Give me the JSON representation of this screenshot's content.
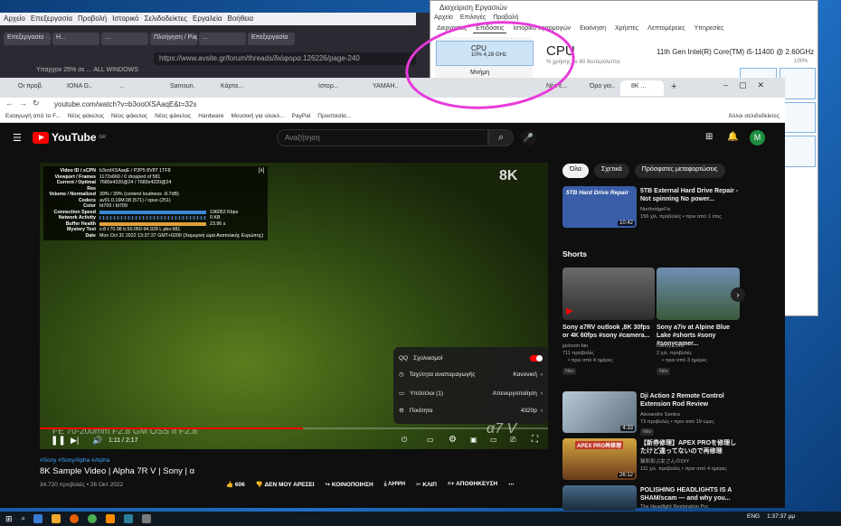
{
  "firefox": {
    "menu": [
      "Αρχείο",
      "Επεξεργασία",
      "Προβολή",
      "Ιστορικό",
      "Σελιδοδείκτες",
      "Εργαλεία",
      "Βοήθεια"
    ],
    "tabs": [
      "Επεξεργασία · ...",
      "Η...",
      "...",
      "Πλοήγηση / Page",
      "...",
      "Επεξεργασία"
    ],
    "url": "https://www.avsite.gr/forum/threads/διάφορα.126226/page-240",
    "bookmarks": "Υπάρχον 25% σε ...   ALL WINDOWS"
  },
  "task_manager": {
    "title": "Διαχείριση Εργασιών",
    "menu": [
      "Αρχείο",
      "Επιλογές",
      "Προβολή"
    ],
    "tabs": [
      "Διεργασίες",
      "Επιδόσεις",
      "Ιστορικό εφαρμογών",
      "Εκκίνηση",
      "Χρήστες",
      "Λεπτομέρειες",
      "Υπηρεσίες"
    ],
    "cpu_label": "CPU",
    "cpu_value": "10%  4,28 GHz",
    "mem_label": "Μνήμη",
    "heading": "CPU",
    "model": "11th Gen Intel(R) Core(TM) i5-11400 @ 2.60GHz",
    "sub": "% χρήσης σε 60 δευτερόλεπτα",
    "pct": "100%"
  },
  "chrome": {
    "tabs": [
      "Οι προβ...",
      "IONA G...",
      "...",
      "Samsun...",
      "Κάρτα...",
      "Νέα...",
      "Ιστορ...",
      "...",
      "YAMAH...",
      "...",
      "BENQ...",
      "Νέα ε...",
      "Όρο γιο...",
      "8K ..."
    ],
    "url": "youtube.com/watch?v=b3ootXSAaqE&t=32s",
    "bookmarks": [
      "Εισαγωγή από το F...",
      "Νέος φάκελος",
      "Νέος φάκελος",
      "Νέος φάκελος",
      "Hardware",
      "Μουσική για ολοκλ...",
      "PayPal",
      "Προστασία...",
      "Άλλοι σελιδοδείκτες"
    ]
  },
  "youtube": {
    "logo": "YouTube",
    "country": "GR",
    "search_placeholder": "Αναζήτηση",
    "avatar": "M",
    "stats": [
      [
        "Video ID / sCPN",
        "b3ootXSAaqE  / P2P5 8V8T 1TF8"
      ],
      [
        "Viewport / Frames",
        "1172x660 / 0 dropped of 581"
      ],
      [
        "Current / Optimal Res",
        "7680x4320@24 / 7680x4320@24"
      ],
      [
        "Volume / Normalized",
        "39% / 39% (content loudness -8.7dB)"
      ],
      [
        "Codecs",
        "av01.0.16M.08 (571) / opus (251)"
      ],
      [
        "Color",
        "bt709 / bt709"
      ],
      [
        "Connection Speed",
        "196052 Kbps"
      ],
      [
        "Network Activity",
        "0 KB"
      ],
      [
        "Buffer Health",
        "23.96 s"
      ],
      [
        "Mystery Text",
        "s:8 t:70.98 b:50.050-94.928 L pbs:981"
      ],
      [
        "Date",
        "Mon Oct 31 2022 13:37:37 GMT+0200 (Χειμερινή ώρα Ανατολικής Ευρώπης)"
      ]
    ],
    "badge_8k": "8K",
    "lens": "FE 70-200mm F2.8 GM OSS II  F2.8",
    "sony": "α7 V",
    "settings": [
      {
        "label": "Σχολιασμοί",
        "value": ""
      },
      {
        "label": "Ταχύτητα αναπαραγωγής",
        "value": "Κανονική"
      },
      {
        "label": "Υπότιτλοι (1)",
        "value": "Απενεργοποίηση"
      },
      {
        "label": "Ποιότητα",
        "value": "4320p"
      }
    ],
    "time": "1:11 / 2:17",
    "tags": "#Sony  #SonyAlpha  #Alpha",
    "title": "8K Sample Video | Alpha 7R V | Sony | α",
    "meta": "34.720 προβολές • 26 Οκτ 2022",
    "actions": [
      "606",
      "ΔΕΝ ΜΟΥ ΑΡΕΣΕΙ",
      "ΚΟΙΝΟΠΟΙΗΣΗ",
      "ΛΗΨΗ",
      "ΚΛΙΠ",
      "ΑΠΟΘΗΚΕΥΣΗ"
    ],
    "chips": [
      "Όλα",
      "Σχετικά",
      "Πρόσφατες μεταφορτώσεις"
    ],
    "rec1": {
      "title": "5TB External Hard Drive Repair - Not spinning No power...",
      "channel": "NorthridgeFix",
      "meta": "156 χιλ. προβολές • πριν από 1 έτος",
      "dur": "10:42",
      "thumb_text": "5TB Hard Drive Repair"
    },
    "shorts_heading": "Shorts",
    "shorts": [
      {
        "title": "Sony a7RV outlook ,8K 30fps or 4K 60fps #sony #camera...",
        "channel": "jackson fan",
        "views": "711 προβολές",
        "age": "• πριν από 4 ημέρες",
        "badge": "Νέο"
      },
      {
        "title": "Sony a7iv at Alpine Blue Lake #shorts #sony #sonycamer...",
        "channel": "Danny Cook",
        "views": "2 χιλ. προβολές",
        "age": "• πριν από 3 ημέρες",
        "badge": "Νέο"
      }
    ],
    "rec2": {
      "title": "Dji Action 2 Remote Control Extension Rod Review",
      "channel": "Alexandre Santos",
      "meta": "73 προβολές • πριν από 19 ώρες",
      "dur": "4:33",
      "badge": "Νέο"
    },
    "rec3": {
      "title": "【新券修理】APEX PROを修理したけど違ってないので再修理",
      "channel": "猫彩彩ぷ女さんのDIY",
      "meta": "111 χιλ. προβολές • πριν από 4 ημέρες",
      "dur": "26:12",
      "thumb_text": "APEX PRO再修理"
    },
    "rec4": {
      "title": "POLISHING HEADLIGHTS IS A SHAM/scam — and why you...",
      "channel": "The Headlight Restoration Pro"
    }
  },
  "taskbar": {
    "lang": "ENG",
    "time": "1:37:37 μμ"
  },
  "colors": {
    "yt_bg": "#0f0f0f",
    "yt_red": "#ff0000",
    "annotation": "#e83ad9"
  }
}
